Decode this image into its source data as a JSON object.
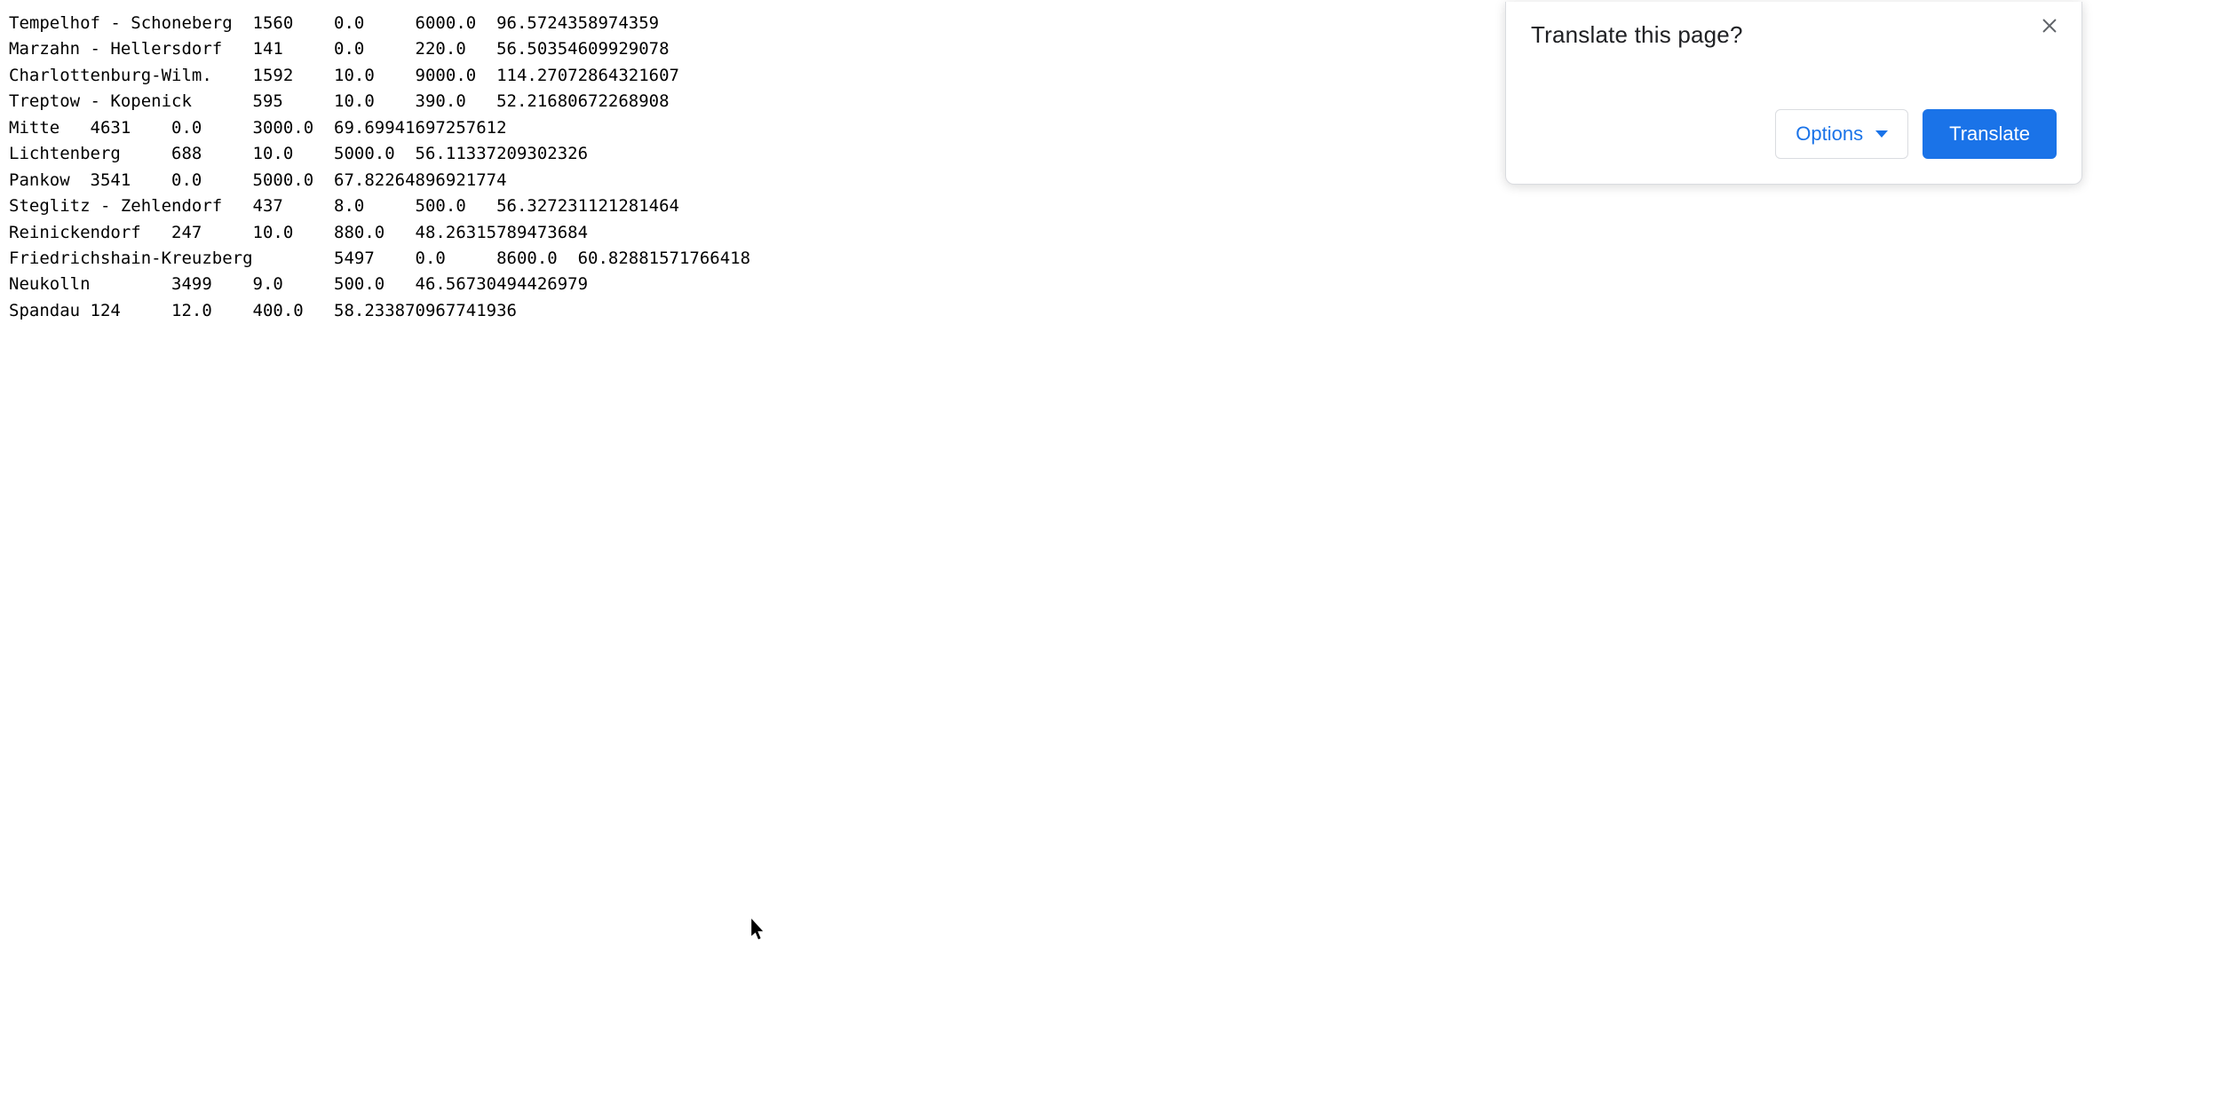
{
  "rows": [
    {
      "name": "Tempelhof - Schoneberg",
      "c1": "1560",
      "c2": "0.0",
      "c3": "6000.0",
      "c4": "96.5724358974359"
    },
    {
      "name": "Marzahn - Hellersdorf",
      "c1": "141",
      "c2": "0.0",
      "c3": "220.0",
      "c4": "56.50354609929078"
    },
    {
      "name": "Charlottenburg-Wilm.",
      "c1": "1592",
      "c2": "10.0",
      "c3": "9000.0",
      "c4": "114.27072864321607"
    },
    {
      "name": "Treptow - Kopenick",
      "c1": "595",
      "c2": "10.0",
      "c3": "390.0",
      "c4": "52.21680672268908"
    },
    {
      "name": "Mitte",
      "c1": "4631",
      "c2": "0.0",
      "c3": "3000.0",
      "c4": "69.69941697257612"
    },
    {
      "name": "Lichtenberg",
      "c1": "688",
      "c2": "10.0",
      "c3": "5000.0",
      "c4": "56.11337209302326"
    },
    {
      "name": "Pankow",
      "c1": "3541",
      "c2": "0.0",
      "c3": "5000.0",
      "c4": "67.82264896921774"
    },
    {
      "name": "Steglitz - Zehlendorf",
      "c1": "437",
      "c2": "8.0",
      "c3": "500.0",
      "c4": "56.327231121281464"
    },
    {
      "name": "Reinickendorf",
      "c1": "247",
      "c2": "10.0",
      "c3": "880.0",
      "c4": "48.26315789473684"
    },
    {
      "name": "Friedrichshain-Kreuzberg",
      "c1": "5497",
      "c2": "0.0",
      "c3": "8600.0",
      "c4": "60.82881571766418"
    },
    {
      "name": "Neukolln",
      "c1": "3499",
      "c2": "9.0",
      "c3": "500.0",
      "c4": "46.56730494426979"
    },
    {
      "name": "Spandau",
      "c1": "124",
      "c2": "12.0",
      "c3": "400.0",
      "c4": "58.233870967741936"
    }
  ],
  "translate_popup": {
    "title": "Translate this page?",
    "options_label": "Options",
    "translate_label": "Translate"
  }
}
